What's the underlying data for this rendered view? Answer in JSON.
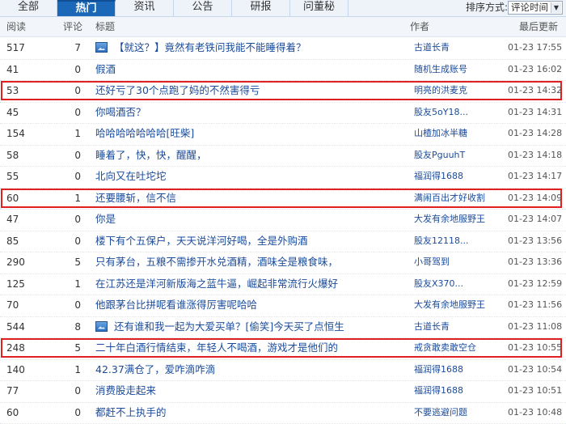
{
  "tabs": [
    {
      "label": "全部",
      "active": false
    },
    {
      "label": "热门",
      "active": true
    },
    {
      "label": "资讯",
      "active": false
    },
    {
      "label": "公告",
      "active": false
    },
    {
      "label": "研报",
      "active": false
    },
    {
      "label": "问董秘",
      "active": false
    }
  ],
  "sort": {
    "label": "排序方式:",
    "selected": "评论时间"
  },
  "columns": {
    "read": "阅读",
    "comments": "评论",
    "title": "标题",
    "author": "作者",
    "updated": "最后更新"
  },
  "rows": [
    {
      "read": "517",
      "comments": "7",
      "title": "【就这？】竟然有老铁问我能不能睡得着？",
      "author": "古道长青",
      "time": "01-23 17:55",
      "icon": "image-icon"
    },
    {
      "read": "41",
      "comments": "0",
      "title": "假酒",
      "author": "随机生成账号",
      "time": "01-23 16:02"
    },
    {
      "read": "53",
      "comments": "0",
      "title": "还好亏了30个点跑了妈的不然害得亏",
      "author": "明亮的洪麦克",
      "time": "01-23 14:32",
      "highlight": true
    },
    {
      "read": "45",
      "comments": "0",
      "title": "你喝酒否？",
      "author": "股友5oY18...",
      "time": "01-23 14:31"
    },
    {
      "read": "154",
      "comments": "1",
      "title": "哈哈哈哈哈哈哈[旺柴]",
      "author": "山楂加冰半糖",
      "time": "01-23 14:28"
    },
    {
      "read": "58",
      "comments": "0",
      "title": "睡着了，快，快，醒醒，",
      "author": "股友PguuhT",
      "time": "01-23 14:18"
    },
    {
      "read": "55",
      "comments": "0",
      "title": "北向又在吐坨坨",
      "author": "福润得1688",
      "time": "01-23 14:17"
    },
    {
      "read": "60",
      "comments": "1",
      "title": "还要腰斩，信不信",
      "author": "满闹百出才好收割",
      "time": "01-23 14:09",
      "highlight": true
    },
    {
      "read": "47",
      "comments": "0",
      "title": "你是",
      "author": "大发有余地服野王",
      "time": "01-23 14:07"
    },
    {
      "read": "85",
      "comments": "0",
      "title": "楼下有个五保户，天天说洋河好喝，全是外购酒",
      "author": "股友12118...",
      "time": "01-23 13:56"
    },
    {
      "read": "290",
      "comments": "5",
      "title": "只有茅台，五粮不需掺开水兑酒精，酒味全是粮食味，",
      "author": "小哥驾到",
      "time": "01-23 13:36"
    },
    {
      "read": "125",
      "comments": "1",
      "title": "在江苏还是洋河新版海之蓝牛逼，崛起非常流行火爆好",
      "author": "股友X370...",
      "time": "01-23 12:59"
    },
    {
      "read": "70",
      "comments": "0",
      "title": "他跟茅台比拼呢看谁涨得厉害呢哈哈",
      "author": "大发有余地服野王",
      "time": "01-23 11:56"
    },
    {
      "read": "544",
      "comments": "8",
      "title": "还有谁和我一起为大爱买单？[偷笑]今天买了点恒生",
      "author": "古道长青",
      "time": "01-23 11:08",
      "icon": "image-icon"
    },
    {
      "read": "248",
      "comments": "5",
      "title": "二十年白酒行情结束，年轻人不喝酒，游戏才是他们的",
      "author": "戒贪敢卖敢空仓",
      "time": "01-23 10:55",
      "highlight": true
    },
    {
      "read": "140",
      "comments": "1",
      "title": "42.37满仓了，爱咋滴咋滴",
      "author": "福润得1688",
      "time": "01-23 10:54"
    },
    {
      "read": "77",
      "comments": "0",
      "title": "消费股走起来",
      "author": "福润得1688",
      "time": "01-23 10:51"
    },
    {
      "read": "60",
      "comments": "0",
      "title": "都赶不上执手的",
      "author": "不要逃避问题",
      "time": "01-23 10:48"
    }
  ]
}
